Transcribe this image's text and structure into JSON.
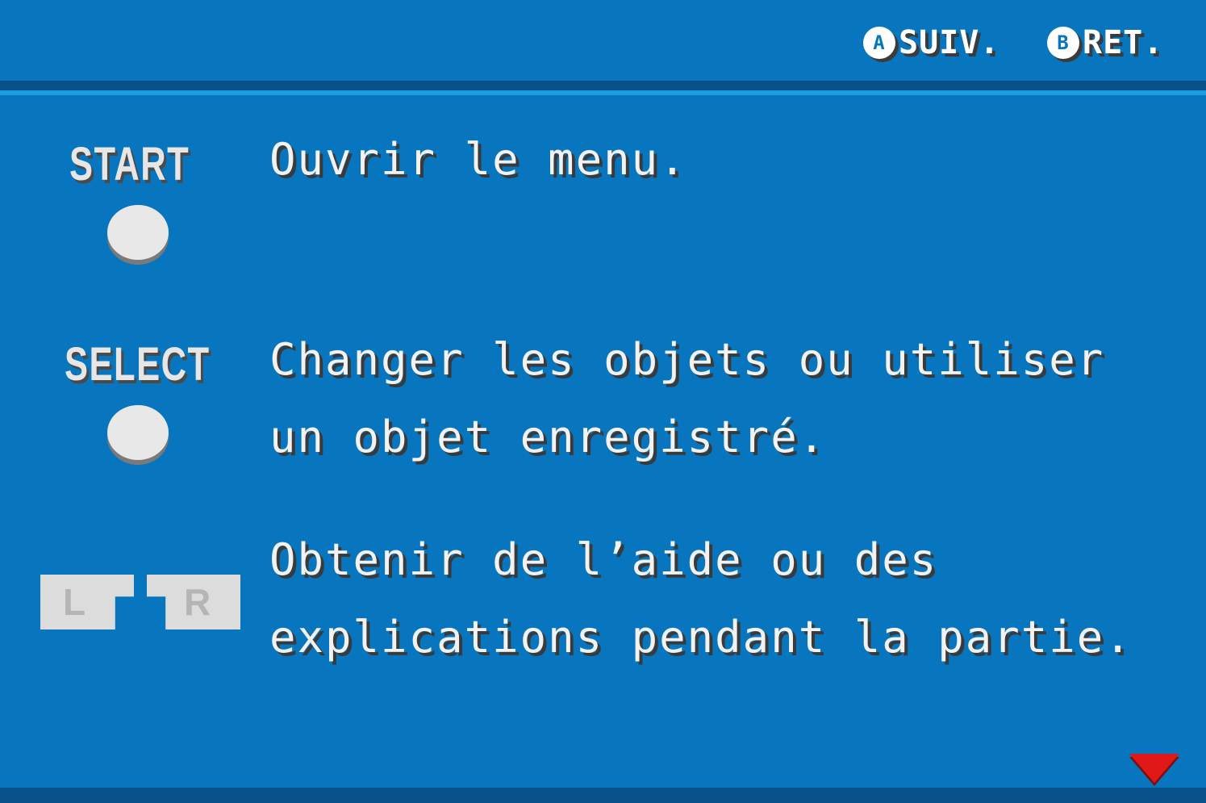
{
  "header": {
    "next_button_glyph": "A",
    "next_label": "SUIV.",
    "back_button_glyph": "B",
    "back_label": "RET."
  },
  "rows": {
    "start": {
      "button_label": "START",
      "description_line1": "Ouvrir le menu."
    },
    "select": {
      "button_label": "SELECT",
      "description_line1": "Changer les objets ou utiliser",
      "description_line2": "un objet enregistré."
    },
    "lr": {
      "left_label": "L",
      "right_label": "R",
      "description_line1": "Obtenir de l’aide ou des",
      "description_line2": "explications pendant la partie."
    }
  },
  "more_indicator": "down-arrow-icon",
  "colors": {
    "background": "#0776be",
    "rule_dark": "#07508a",
    "rule_light": "#1aa0e0",
    "arrow": "#e01818"
  }
}
